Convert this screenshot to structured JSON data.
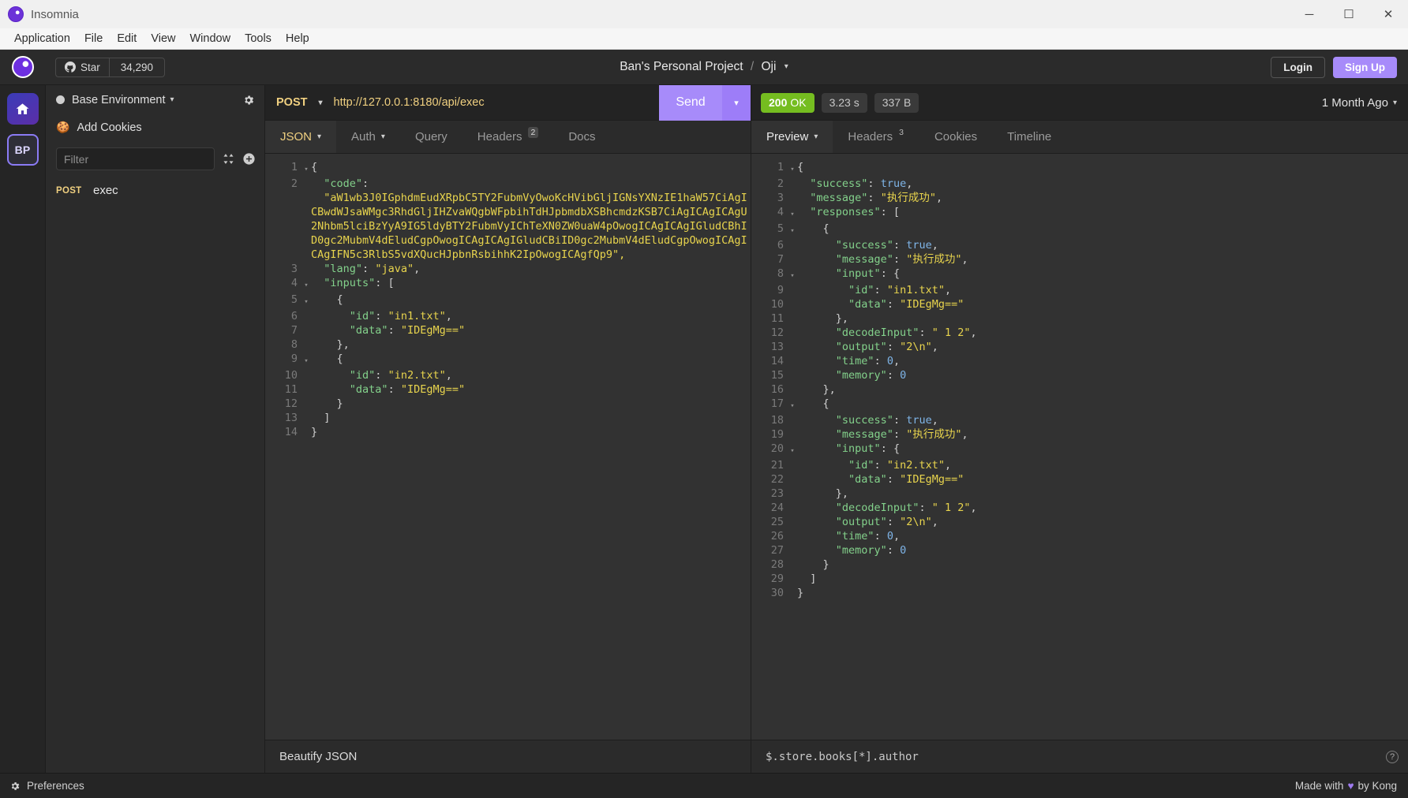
{
  "window": {
    "app_title": "Insomnia",
    "logo_icon": "insomnia-logo-icon",
    "minimize_icon": "minimize-icon",
    "maximize_icon": "maximize-icon",
    "close_icon": "close-icon",
    "minimize_glyph": "─",
    "maximize_glyph": "☐",
    "close_glyph": "✕"
  },
  "menubar": {
    "items": [
      {
        "label": "Application"
      },
      {
        "label": "File"
      },
      {
        "label": "Edit"
      },
      {
        "label": "View"
      },
      {
        "label": "Window"
      },
      {
        "label": "Tools"
      },
      {
        "label": "Help"
      }
    ]
  },
  "header": {
    "github": {
      "star_label": "Star",
      "star_count": "34,290",
      "icon": "github-icon"
    },
    "breadcrumb": {
      "workspace": "Ban's Personal Project",
      "separator": "/",
      "project": "Oji",
      "caret": "▾"
    },
    "login_label": "Login",
    "signup_label": "Sign Up",
    "accent_color": "#a78bfa"
  },
  "rail": {
    "home": {
      "name": "home-icon",
      "label": ""
    },
    "project": {
      "initials": "BP"
    }
  },
  "sidebar": {
    "environment": {
      "label": "Base Environment",
      "caret": "▾",
      "dot_color": "#cfcfcf"
    },
    "settings_icon": "gear-icon",
    "cookies": {
      "label": "Add Cookies",
      "icon": "cookie-icon"
    },
    "filter": {
      "placeholder": "Filter",
      "value": ""
    },
    "sort_icon": "sort-icon",
    "add_icon": "plus-circle-icon",
    "requests": [
      {
        "method": "POST",
        "name": "exec"
      }
    ]
  },
  "request": {
    "method": "POST",
    "method_caret": "▾",
    "url": "http://127.0.0.1:8180/api/exec",
    "send_label": "Send",
    "send_caret": "▾",
    "tabs": [
      {
        "label": "JSON",
        "caret": "▾",
        "active": true,
        "badge": ""
      },
      {
        "label": "Auth",
        "caret": "▾",
        "active": false,
        "badge": ""
      },
      {
        "label": "Query",
        "caret": "",
        "active": false,
        "badge": ""
      },
      {
        "label": "Headers",
        "caret": "",
        "active": false,
        "badge": "2"
      },
      {
        "label": "Docs",
        "caret": "",
        "active": false,
        "badge": ""
      }
    ],
    "footer": {
      "beautify_label": "Beautify JSON"
    },
    "body_lines": [
      {
        "num": "1",
        "fold": "▾",
        "wrap": false,
        "tokens": [
          {
            "t": "{",
            "c": "p"
          }
        ]
      },
      {
        "num": "2",
        "fold": "",
        "wrap": false,
        "tokens": [
          {
            "t": "  ",
            "c": "p"
          },
          {
            "t": "\"code\"",
            "c": "k"
          },
          {
            "t": ":",
            "c": "p"
          }
        ]
      },
      {
        "num": "",
        "fold": "",
        "wrap": true,
        "tokens": [
          {
            "t": "  \"aW1wb3J0IGphdmEudXRpbC5TY2FubmVyOwoKcHVibGljIGNsYXNzIE1haW57CiAgICBwdWJsaWMgc3RhdGljIHZvaWQgbWFpbihTdHJpbmdbXSBhcmdzKSB7CiAgICAgICAgU2Nhbm5lciBzYyA9IG5ldyBTY2FubmVyIChTeXN0ZW0uaW4pOwogICAgICAgIGludCBhID0gc2MubmV4dEludCgpOwogICAgICAgIGludCBiID0gc2MubmV4dEludCgpOwogICAgICAgIFN5c3RlbS5vdXQucHJpbnRsbihhK2IpOwogICAgfQp9\",",
            "c": "s"
          }
        ]
      },
      {
        "num": "3",
        "fold": "",
        "wrap": false,
        "tokens": [
          {
            "t": "  ",
            "c": "p"
          },
          {
            "t": "\"lang\"",
            "c": "k"
          },
          {
            "t": ": ",
            "c": "p"
          },
          {
            "t": "\"java\"",
            "c": "s"
          },
          {
            "t": ",",
            "c": "p"
          }
        ]
      },
      {
        "num": "4",
        "fold": "▾",
        "wrap": false,
        "tokens": [
          {
            "t": "  ",
            "c": "p"
          },
          {
            "t": "\"inputs\"",
            "c": "k"
          },
          {
            "t": ": [",
            "c": "p"
          }
        ]
      },
      {
        "num": "5",
        "fold": "▾",
        "wrap": false,
        "tokens": [
          {
            "t": "    {",
            "c": "p"
          }
        ]
      },
      {
        "num": "6",
        "fold": "",
        "wrap": false,
        "tokens": [
          {
            "t": "      ",
            "c": "p"
          },
          {
            "t": "\"id\"",
            "c": "k"
          },
          {
            "t": ": ",
            "c": "p"
          },
          {
            "t": "\"in1.txt\"",
            "c": "s"
          },
          {
            "t": ",",
            "c": "p"
          }
        ]
      },
      {
        "num": "7",
        "fold": "",
        "wrap": false,
        "tokens": [
          {
            "t": "      ",
            "c": "p"
          },
          {
            "t": "\"data\"",
            "c": "k"
          },
          {
            "t": ": ",
            "c": "p"
          },
          {
            "t": "\"IDEgMg==\"",
            "c": "s"
          }
        ]
      },
      {
        "num": "8",
        "fold": "",
        "wrap": false,
        "tokens": [
          {
            "t": "    },",
            "c": "p"
          }
        ]
      },
      {
        "num": "9",
        "fold": "▾",
        "wrap": false,
        "tokens": [
          {
            "t": "    {",
            "c": "p"
          }
        ]
      },
      {
        "num": "10",
        "fold": "",
        "wrap": false,
        "tokens": [
          {
            "t": "      ",
            "c": "p"
          },
          {
            "t": "\"id\"",
            "c": "k"
          },
          {
            "t": ": ",
            "c": "p"
          },
          {
            "t": "\"in2.txt\"",
            "c": "s"
          },
          {
            "t": ",",
            "c": "p"
          }
        ]
      },
      {
        "num": "11",
        "fold": "",
        "wrap": false,
        "tokens": [
          {
            "t": "      ",
            "c": "p"
          },
          {
            "t": "\"data\"",
            "c": "k"
          },
          {
            "t": ": ",
            "c": "p"
          },
          {
            "t": "\"IDEgMg==\"",
            "c": "s"
          }
        ]
      },
      {
        "num": "12",
        "fold": "",
        "wrap": false,
        "tokens": [
          {
            "t": "    }",
            "c": "p"
          }
        ]
      },
      {
        "num": "13",
        "fold": "",
        "wrap": false,
        "tokens": [
          {
            "t": "  ]",
            "c": "p"
          }
        ]
      },
      {
        "num": "14",
        "fold": "",
        "wrap": false,
        "tokens": [
          {
            "t": "}",
            "c": "p"
          }
        ]
      }
    ]
  },
  "response": {
    "status_code": "200",
    "status_text": "OK",
    "status_color": "#75bd20",
    "time": "3.23 s",
    "size": "337 B",
    "history_label": "1 Month Ago",
    "history_caret": "▾",
    "tabs": [
      {
        "label": "Preview",
        "caret": "▾",
        "active": true,
        "badge": ""
      },
      {
        "label": "Headers",
        "caret": "",
        "active": false,
        "badge": "3"
      },
      {
        "label": "Cookies",
        "caret": "",
        "active": false,
        "badge": ""
      },
      {
        "label": "Timeline",
        "caret": "",
        "active": false,
        "badge": ""
      }
    ],
    "footer": {
      "filter_expression": "$.store.books[*].author",
      "help_icon": "help-circle-icon",
      "help_glyph": "?"
    },
    "body_lines": [
      {
        "num": "1",
        "fold": "▾",
        "tokens": [
          {
            "t": "{",
            "c": "p"
          }
        ]
      },
      {
        "num": "2",
        "fold": "",
        "tokens": [
          {
            "t": "  ",
            "c": "p"
          },
          {
            "t": "\"success\"",
            "c": "k"
          },
          {
            "t": ": ",
            "c": "p"
          },
          {
            "t": "true",
            "c": "n"
          },
          {
            "t": ",",
            "c": "p"
          }
        ]
      },
      {
        "num": "3",
        "fold": "",
        "tokens": [
          {
            "t": "  ",
            "c": "p"
          },
          {
            "t": "\"message\"",
            "c": "k"
          },
          {
            "t": ": ",
            "c": "p"
          },
          {
            "t": "\"执行成功\"",
            "c": "s"
          },
          {
            "t": ",",
            "c": "p"
          }
        ]
      },
      {
        "num": "4",
        "fold": "▾",
        "tokens": [
          {
            "t": "  ",
            "c": "p"
          },
          {
            "t": "\"responses\"",
            "c": "k"
          },
          {
            "t": ": [",
            "c": "p"
          }
        ]
      },
      {
        "num": "5",
        "fold": "▾",
        "tokens": [
          {
            "t": "    {",
            "c": "p"
          }
        ]
      },
      {
        "num": "6",
        "fold": "",
        "tokens": [
          {
            "t": "      ",
            "c": "p"
          },
          {
            "t": "\"success\"",
            "c": "k"
          },
          {
            "t": ": ",
            "c": "p"
          },
          {
            "t": "true",
            "c": "n"
          },
          {
            "t": ",",
            "c": "p"
          }
        ]
      },
      {
        "num": "7",
        "fold": "",
        "tokens": [
          {
            "t": "      ",
            "c": "p"
          },
          {
            "t": "\"message\"",
            "c": "k"
          },
          {
            "t": ": ",
            "c": "p"
          },
          {
            "t": "\"执行成功\"",
            "c": "s"
          },
          {
            "t": ",",
            "c": "p"
          }
        ]
      },
      {
        "num": "8",
        "fold": "▾",
        "tokens": [
          {
            "t": "      ",
            "c": "p"
          },
          {
            "t": "\"input\"",
            "c": "k"
          },
          {
            "t": ": {",
            "c": "p"
          }
        ]
      },
      {
        "num": "9",
        "fold": "",
        "tokens": [
          {
            "t": "        ",
            "c": "p"
          },
          {
            "t": "\"id\"",
            "c": "k"
          },
          {
            "t": ": ",
            "c": "p"
          },
          {
            "t": "\"in1.txt\"",
            "c": "s"
          },
          {
            "t": ",",
            "c": "p"
          }
        ]
      },
      {
        "num": "10",
        "fold": "",
        "tokens": [
          {
            "t": "        ",
            "c": "p"
          },
          {
            "t": "\"data\"",
            "c": "k"
          },
          {
            "t": ": ",
            "c": "p"
          },
          {
            "t": "\"IDEgMg==\"",
            "c": "s"
          }
        ]
      },
      {
        "num": "11",
        "fold": "",
        "tokens": [
          {
            "t": "      },",
            "c": "p"
          }
        ]
      },
      {
        "num": "12",
        "fold": "",
        "tokens": [
          {
            "t": "      ",
            "c": "p"
          },
          {
            "t": "\"decodeInput\"",
            "c": "k"
          },
          {
            "t": ": ",
            "c": "p"
          },
          {
            "t": "\" 1 2\"",
            "c": "s"
          },
          {
            "t": ",",
            "c": "p"
          }
        ]
      },
      {
        "num": "13",
        "fold": "",
        "tokens": [
          {
            "t": "      ",
            "c": "p"
          },
          {
            "t": "\"output\"",
            "c": "k"
          },
          {
            "t": ": ",
            "c": "p"
          },
          {
            "t": "\"2\\n\"",
            "c": "s"
          },
          {
            "t": ",",
            "c": "p"
          }
        ]
      },
      {
        "num": "14",
        "fold": "",
        "tokens": [
          {
            "t": "      ",
            "c": "p"
          },
          {
            "t": "\"time\"",
            "c": "k"
          },
          {
            "t": ": ",
            "c": "p"
          },
          {
            "t": "0",
            "c": "n"
          },
          {
            "t": ",",
            "c": "p"
          }
        ]
      },
      {
        "num": "15",
        "fold": "",
        "tokens": [
          {
            "t": "      ",
            "c": "p"
          },
          {
            "t": "\"memory\"",
            "c": "k"
          },
          {
            "t": ": ",
            "c": "p"
          },
          {
            "t": "0",
            "c": "n"
          }
        ]
      },
      {
        "num": "16",
        "fold": "",
        "tokens": [
          {
            "t": "    },",
            "c": "p"
          }
        ]
      },
      {
        "num": "17",
        "fold": "▾",
        "tokens": [
          {
            "t": "    {",
            "c": "p"
          }
        ]
      },
      {
        "num": "18",
        "fold": "",
        "tokens": [
          {
            "t": "      ",
            "c": "p"
          },
          {
            "t": "\"success\"",
            "c": "k"
          },
          {
            "t": ": ",
            "c": "p"
          },
          {
            "t": "true",
            "c": "n"
          },
          {
            "t": ",",
            "c": "p"
          }
        ]
      },
      {
        "num": "19",
        "fold": "",
        "tokens": [
          {
            "t": "      ",
            "c": "p"
          },
          {
            "t": "\"message\"",
            "c": "k"
          },
          {
            "t": ": ",
            "c": "p"
          },
          {
            "t": "\"执行成功\"",
            "c": "s"
          },
          {
            "t": ",",
            "c": "p"
          }
        ]
      },
      {
        "num": "20",
        "fold": "▾",
        "tokens": [
          {
            "t": "      ",
            "c": "p"
          },
          {
            "t": "\"input\"",
            "c": "k"
          },
          {
            "t": ": {",
            "c": "p"
          }
        ]
      },
      {
        "num": "21",
        "fold": "",
        "tokens": [
          {
            "t": "        ",
            "c": "p"
          },
          {
            "t": "\"id\"",
            "c": "k"
          },
          {
            "t": ": ",
            "c": "p"
          },
          {
            "t": "\"in2.txt\"",
            "c": "s"
          },
          {
            "t": ",",
            "c": "p"
          }
        ]
      },
      {
        "num": "22",
        "fold": "",
        "tokens": [
          {
            "t": "        ",
            "c": "p"
          },
          {
            "t": "\"data\"",
            "c": "k"
          },
          {
            "t": ": ",
            "c": "p"
          },
          {
            "t": "\"IDEgMg==\"",
            "c": "s"
          }
        ]
      },
      {
        "num": "23",
        "fold": "",
        "tokens": [
          {
            "t": "      },",
            "c": "p"
          }
        ]
      },
      {
        "num": "24",
        "fold": "",
        "tokens": [
          {
            "t": "      ",
            "c": "p"
          },
          {
            "t": "\"decodeInput\"",
            "c": "k"
          },
          {
            "t": ": ",
            "c": "p"
          },
          {
            "t": "\" 1 2\"",
            "c": "s"
          },
          {
            "t": ",",
            "c": "p"
          }
        ]
      },
      {
        "num": "25",
        "fold": "",
        "tokens": [
          {
            "t": "      ",
            "c": "p"
          },
          {
            "t": "\"output\"",
            "c": "k"
          },
          {
            "t": ": ",
            "c": "p"
          },
          {
            "t": "\"2\\n\"",
            "c": "s"
          },
          {
            "t": ",",
            "c": "p"
          }
        ]
      },
      {
        "num": "26",
        "fold": "",
        "tokens": [
          {
            "t": "      ",
            "c": "p"
          },
          {
            "t": "\"time\"",
            "c": "k"
          },
          {
            "t": ": ",
            "c": "p"
          },
          {
            "t": "0",
            "c": "n"
          },
          {
            "t": ",",
            "c": "p"
          }
        ]
      },
      {
        "num": "27",
        "fold": "",
        "tokens": [
          {
            "t": "      ",
            "c": "p"
          },
          {
            "t": "\"memory\"",
            "c": "k"
          },
          {
            "t": ": ",
            "c": "p"
          },
          {
            "t": "0",
            "c": "n"
          }
        ]
      },
      {
        "num": "28",
        "fold": "",
        "tokens": [
          {
            "t": "    }",
            "c": "p"
          }
        ]
      },
      {
        "num": "29",
        "fold": "",
        "tokens": [
          {
            "t": "  ]",
            "c": "p"
          }
        ]
      },
      {
        "num": "30",
        "fold": "",
        "tokens": [
          {
            "t": "}",
            "c": "p"
          }
        ]
      }
    ]
  },
  "statusbar": {
    "preferences_label": "Preferences",
    "preferences_icon": "gear-icon",
    "made_with_prefix": "Made with",
    "made_with_heart": "♥",
    "made_with_suffix": "by Kong"
  }
}
